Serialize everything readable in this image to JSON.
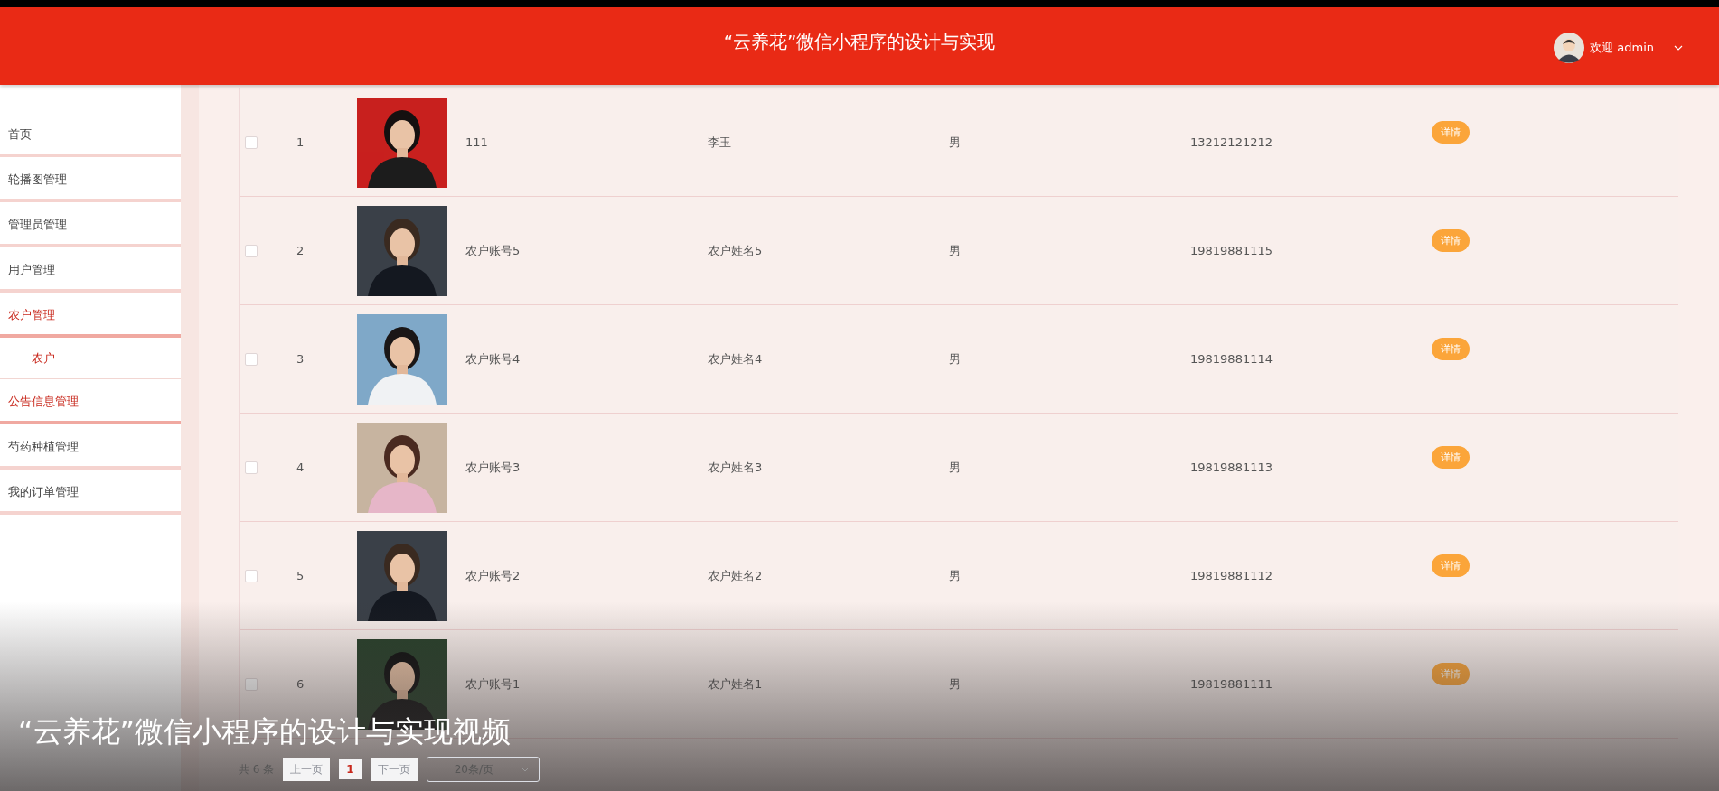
{
  "header": {
    "title": "“云养花”微信小程序的设计与实现",
    "user": "欢迎 admin"
  },
  "sidebar": {
    "items": [
      {
        "label": "首页",
        "active": false
      },
      {
        "label": "轮播图管理",
        "active": false
      },
      {
        "label": "管理员管理",
        "active": false
      },
      {
        "label": "用户管理",
        "active": false
      },
      {
        "label": "农户管理",
        "active": true,
        "children": [
          {
            "label": "农户",
            "selected": true
          }
        ]
      },
      {
        "label": "公告信息管理",
        "active": true
      },
      {
        "label": "芍药种植管理",
        "active": false
      },
      {
        "label": "我的订单管理",
        "active": false
      }
    ]
  },
  "table": {
    "rows": [
      {
        "checked": false,
        "index": "1",
        "account": "111",
        "name": "李玉",
        "gender": "男",
        "phone": "13212121212",
        "action": "详情"
      },
      {
        "checked": false,
        "index": "2",
        "account": "农户账号5",
        "name": "农户姓名5",
        "gender": "男",
        "phone": "19819881115",
        "action": "详情"
      },
      {
        "checked": false,
        "index": "3",
        "account": "农户账号4",
        "name": "农户姓名4",
        "gender": "男",
        "phone": "19819881114",
        "action": "详情"
      },
      {
        "checked": false,
        "index": "4",
        "account": "农户账号3",
        "name": "农户姓名3",
        "gender": "男",
        "phone": "19819881113",
        "action": "详情"
      },
      {
        "checked": false,
        "index": "5",
        "account": "农户账号2",
        "name": "农户姓名2",
        "gender": "男",
        "phone": "19819881112",
        "action": "详情"
      },
      {
        "checked": false,
        "index": "6",
        "account": "农户账号1",
        "name": "农户姓名1",
        "gender": "男",
        "phone": "19819881111",
        "action": "详情"
      }
    ]
  },
  "pagination": {
    "total": "共 6 条",
    "prev": {
      "label": "上一页",
      "disabled": true
    },
    "pages": [
      {
        "label": "1",
        "selected": true
      }
    ],
    "next": {
      "label": "下一页",
      "disabled": true
    },
    "page_size": "20条/页"
  },
  "caption": "“云养花”微信小程序的设计与实现视频"
}
